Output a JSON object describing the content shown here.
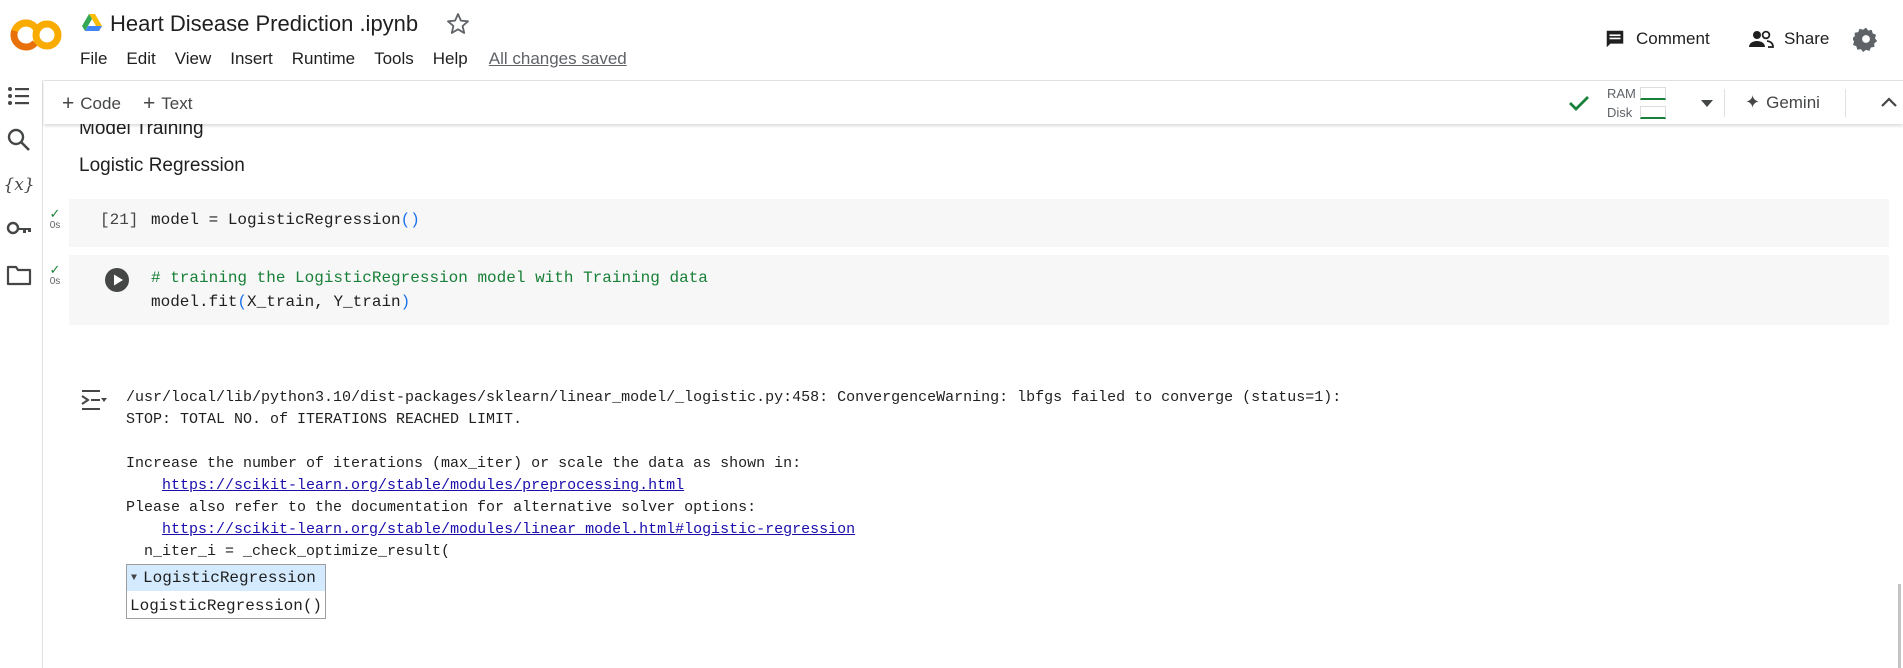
{
  "header": {
    "logo_text": "CO",
    "notebook_title": "Heart Disease Prediction .ipynb",
    "menu": [
      "File",
      "Edit",
      "View",
      "Insert",
      "Runtime",
      "Tools",
      "Help"
    ],
    "save_status": "All changes saved",
    "comment_label": "Comment",
    "share_label": "Share"
  },
  "toolbar": {
    "add_code_label": "Code",
    "add_text_label": "Text",
    "ram_label": "RAM",
    "disk_label": "Disk",
    "gemini_label": "Gemini"
  },
  "notebook": {
    "heading_model_training": "Model Training",
    "heading_logistic_regression": "Logistic Regression",
    "cell1": {
      "exec_count": "[21]",
      "status_time": "0s",
      "code": "model = LogisticRegression",
      "code_parens": "()"
    },
    "cell2": {
      "status_time": "0s",
      "comment_line": "# training the LogisticRegression model with Training data",
      "code_prefix": "model.fit",
      "code_open": "(",
      "code_args": "X_train, Y_train",
      "code_close": ")"
    },
    "output": {
      "line1": "/usr/local/lib/python3.10/dist-packages/sklearn/linear_model/_logistic.py:458: ConvergenceWarning: lbfgs failed to converge (status=1):",
      "line2": "STOP: TOTAL NO. of ITERATIONS REACHED LIMIT.",
      "line3": "Increase the number of iterations (max_iter) or scale the data as shown in:",
      "link1": "https://scikit-learn.org/stable/modules/preprocessing.html",
      "line4": "Please also refer to the documentation for alternative solver options:",
      "link2": "https://scikit-learn.org/stable/modules/linear_model.html#logistic-regression",
      "line5": "  n_iter_i = _check_optimize_result(",
      "widget_title": "LogisticRegression",
      "widget_body": "LogisticRegression()"
    }
  },
  "colors": {
    "accent_green": "#188038",
    "link_blue": "#1a0dab",
    "logo_orange": "#f9ab00",
    "widget_header": "#d4ebff"
  }
}
